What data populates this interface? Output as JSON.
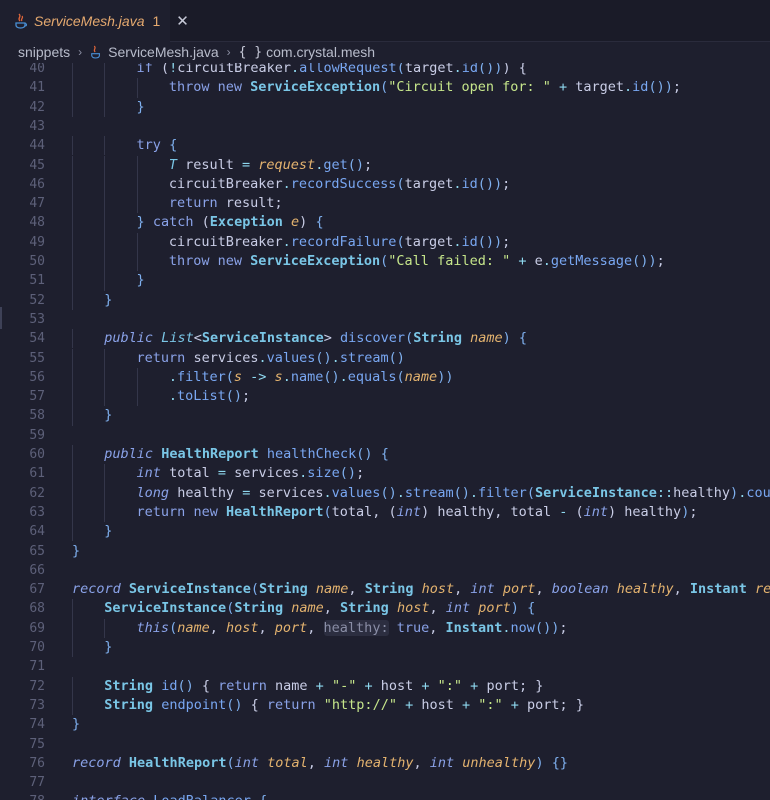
{
  "tab": {
    "title": "ServiceMesh.java",
    "problem_count": "1",
    "close_glyph": "✕",
    "icon": "java-icon"
  },
  "breadcrumb": {
    "items": [
      "snippets",
      "ServiceMesh.java",
      "com.crystal.mesh"
    ],
    "separator": "›",
    "namespace_icon": "{ }"
  },
  "colors": {
    "background": "#1e1f2e",
    "tab_title": "#e5a96f",
    "keyword": "#8aa2e8",
    "type": "#7ac6e6",
    "function": "#79a7f2",
    "parameter": "#e4b36f",
    "string": "#c6e68b",
    "line_number": "#5d6079"
  },
  "lines": [
    {
      "n": "40",
      "indent": 2,
      "t": [
        [
          "kw",
          "if"
        ],
        [
          "pl",
          " ("
        ],
        [
          "op",
          "!"
        ],
        [
          "pl",
          "circuitBreaker"
        ],
        [
          "op",
          "."
        ],
        [
          "fn",
          "allowRequest"
        ],
        [
          "br",
          "("
        ],
        [
          "pl",
          "target"
        ],
        [
          "op",
          "."
        ],
        [
          "fn",
          "id"
        ],
        [
          "br",
          "()"
        ],
        [
          "br",
          ")"
        ],
        [
          "pl",
          ")"
        ],
        [
          "pl",
          " {"
        ]
      ]
    },
    {
      "n": "41",
      "indent": 3,
      "t": [
        [
          "kw",
          "throw new "
        ],
        [
          "ty",
          "ServiceException"
        ],
        [
          "br",
          "("
        ],
        [
          "str",
          "\"Circuit open for: \""
        ],
        [
          "op",
          " + "
        ],
        [
          "pl",
          "target"
        ],
        [
          "op",
          "."
        ],
        [
          "fn",
          "id"
        ],
        [
          "br",
          "()"
        ],
        [
          "br",
          ")"
        ],
        [
          "pl",
          ";"
        ]
      ]
    },
    {
      "n": "42",
      "indent": 2,
      "t": [
        [
          "br",
          "}"
        ]
      ]
    },
    {
      "n": "43",
      "indent": 0,
      "t": []
    },
    {
      "n": "44",
      "indent": 2,
      "t": [
        [
          "kw",
          "try"
        ],
        [
          "pl",
          " "
        ],
        [
          "br",
          "{"
        ]
      ]
    },
    {
      "n": "45",
      "indent": 3,
      "t": [
        [
          "tyi",
          "T"
        ],
        [
          "pl",
          " result "
        ],
        [
          "op",
          "="
        ],
        [
          "pl",
          " "
        ],
        [
          "par",
          "request"
        ],
        [
          "op",
          "."
        ],
        [
          "fn",
          "get"
        ],
        [
          "br",
          "()"
        ],
        [
          "pl",
          ";"
        ]
      ]
    },
    {
      "n": "46",
      "indent": 3,
      "t": [
        [
          "pl",
          "circuitBreaker"
        ],
        [
          "op",
          "."
        ],
        [
          "fn",
          "recordSuccess"
        ],
        [
          "br",
          "("
        ],
        [
          "pl",
          "target"
        ],
        [
          "op",
          "."
        ],
        [
          "fn",
          "id"
        ],
        [
          "br",
          "()"
        ],
        [
          "br",
          ")"
        ],
        [
          "pl",
          ";"
        ]
      ]
    },
    {
      "n": "47",
      "indent": 3,
      "t": [
        [
          "kw",
          "return"
        ],
        [
          "pl",
          " result;"
        ]
      ]
    },
    {
      "n": "48",
      "indent": 2,
      "t": [
        [
          "br",
          "}"
        ],
        [
          "pl",
          " "
        ],
        [
          "kw",
          "catch"
        ],
        [
          "pl",
          " ("
        ],
        [
          "ty",
          "Exception"
        ],
        [
          "pl",
          " "
        ],
        [
          "par",
          "e"
        ],
        [
          "pl",
          ")"
        ],
        [
          "pl",
          " "
        ],
        [
          "br",
          "{"
        ]
      ]
    },
    {
      "n": "49",
      "indent": 3,
      "t": [
        [
          "pl",
          "circuitBreaker"
        ],
        [
          "op",
          "."
        ],
        [
          "fn",
          "recordFailure"
        ],
        [
          "br",
          "("
        ],
        [
          "pl",
          "target"
        ],
        [
          "op",
          "."
        ],
        [
          "fn",
          "id"
        ],
        [
          "br",
          "()"
        ],
        [
          "br",
          ")"
        ],
        [
          "pl",
          ";"
        ]
      ]
    },
    {
      "n": "50",
      "indent": 3,
      "t": [
        [
          "kw",
          "throw new "
        ],
        [
          "ty",
          "ServiceException"
        ],
        [
          "br",
          "("
        ],
        [
          "str",
          "\"Call failed: \""
        ],
        [
          "op",
          " + "
        ],
        [
          "pl",
          "e"
        ],
        [
          "op",
          "."
        ],
        [
          "fn",
          "getMessage"
        ],
        [
          "br",
          "()"
        ],
        [
          "br",
          ")"
        ],
        [
          "pl",
          ";"
        ]
      ]
    },
    {
      "n": "51",
      "indent": 2,
      "t": [
        [
          "br",
          "}"
        ]
      ]
    },
    {
      "n": "52",
      "indent": 1,
      "t": [
        [
          "br",
          "}"
        ]
      ]
    },
    {
      "n": "53",
      "indent": 0,
      "t": []
    },
    {
      "n": "54",
      "indent": 1,
      "t": [
        [
          "kwi",
          "public"
        ],
        [
          "pl",
          " "
        ],
        [
          "tyi",
          "List"
        ],
        [
          "pl",
          "<"
        ],
        [
          "ty",
          "ServiceInstance"
        ],
        [
          "pl",
          "> "
        ],
        [
          "fn",
          "discover"
        ],
        [
          "br",
          "("
        ],
        [
          "ty",
          "String"
        ],
        [
          "pl",
          " "
        ],
        [
          "par",
          "name"
        ],
        [
          "br",
          ")"
        ],
        [
          "pl",
          " "
        ],
        [
          "br",
          "{"
        ]
      ]
    },
    {
      "n": "55",
      "indent": 2,
      "t": [
        [
          "kw",
          "return"
        ],
        [
          "pl",
          " services"
        ],
        [
          "op",
          "."
        ],
        [
          "fn",
          "values"
        ],
        [
          "br",
          "()"
        ],
        [
          "op",
          "."
        ],
        [
          "fn",
          "stream"
        ],
        [
          "br",
          "()"
        ]
      ]
    },
    {
      "n": "56",
      "indent": 3,
      "t": [
        [
          "op",
          "."
        ],
        [
          "fn",
          "filter"
        ],
        [
          "br",
          "("
        ],
        [
          "par",
          "s"
        ],
        [
          "op",
          " -> "
        ],
        [
          "par",
          "s"
        ],
        [
          "op",
          "."
        ],
        [
          "fn",
          "name"
        ],
        [
          "br",
          "()"
        ],
        [
          "op",
          "."
        ],
        [
          "fn",
          "equals"
        ],
        [
          "br",
          "("
        ],
        [
          "par",
          "name"
        ],
        [
          "br",
          "))"
        ]
      ]
    },
    {
      "n": "57",
      "indent": 3,
      "t": [
        [
          "op",
          "."
        ],
        [
          "fn",
          "toList"
        ],
        [
          "br",
          "()"
        ],
        [
          "pl",
          ";"
        ]
      ]
    },
    {
      "n": "58",
      "indent": 1,
      "t": [
        [
          "br",
          "}"
        ]
      ]
    },
    {
      "n": "59",
      "indent": 0,
      "t": []
    },
    {
      "n": "60",
      "indent": 1,
      "t": [
        [
          "kwi",
          "public"
        ],
        [
          "pl",
          " "
        ],
        [
          "ty",
          "HealthReport"
        ],
        [
          "pl",
          " "
        ],
        [
          "fn",
          "healthCheck"
        ],
        [
          "br",
          "()"
        ],
        [
          "pl",
          " "
        ],
        [
          "br",
          "{"
        ]
      ]
    },
    {
      "n": "61",
      "indent": 2,
      "t": [
        [
          "kwi",
          "int"
        ],
        [
          "pl",
          " total "
        ],
        [
          "op",
          "="
        ],
        [
          "pl",
          " services"
        ],
        [
          "op",
          "."
        ],
        [
          "fn",
          "size"
        ],
        [
          "br",
          "()"
        ],
        [
          "pl",
          ";"
        ]
      ]
    },
    {
      "n": "62",
      "indent": 2,
      "t": [
        [
          "kwi",
          "long"
        ],
        [
          "pl",
          " healthy "
        ],
        [
          "op",
          "="
        ],
        [
          "pl",
          " services"
        ],
        [
          "op",
          "."
        ],
        [
          "fn",
          "values"
        ],
        [
          "br",
          "()"
        ],
        [
          "op",
          "."
        ],
        [
          "fn",
          "stream"
        ],
        [
          "br",
          "()"
        ],
        [
          "op",
          "."
        ],
        [
          "fn",
          "filter"
        ],
        [
          "br",
          "("
        ],
        [
          "ty",
          "ServiceInstance"
        ],
        [
          "op",
          "::"
        ],
        [
          "pl",
          "healthy"
        ],
        [
          "br",
          ")"
        ],
        [
          "op",
          "."
        ],
        [
          "fn",
          "count"
        ],
        [
          "br",
          "()"
        ],
        [
          "pl",
          ";"
        ]
      ]
    },
    {
      "n": "63",
      "indent": 2,
      "t": [
        [
          "kw",
          "return new "
        ],
        [
          "ty",
          "HealthReport"
        ],
        [
          "br",
          "("
        ],
        [
          "pl",
          "total, ("
        ],
        [
          "kwi",
          "int"
        ],
        [
          "pl",
          ") healthy, total "
        ],
        [
          "op",
          "-"
        ],
        [
          "pl",
          " ("
        ],
        [
          "kwi",
          "int"
        ],
        [
          "pl",
          ") healthy"
        ],
        [
          "br",
          ")"
        ],
        [
          "pl",
          ";"
        ]
      ]
    },
    {
      "n": "64",
      "indent": 1,
      "t": [
        [
          "br",
          "}"
        ]
      ]
    },
    {
      "n": "65",
      "indent": 0,
      "t": [
        [
          "br",
          "}"
        ]
      ]
    },
    {
      "n": "66",
      "indent": 0,
      "t": []
    },
    {
      "n": "67",
      "indent": 0,
      "t": [
        [
          "kwi",
          "record"
        ],
        [
          "pl",
          " "
        ],
        [
          "ty",
          "ServiceInstance"
        ],
        [
          "br",
          "("
        ],
        [
          "ty",
          "String"
        ],
        [
          "pl",
          " "
        ],
        [
          "par",
          "name"
        ],
        [
          "pl",
          ", "
        ],
        [
          "ty",
          "String"
        ],
        [
          "pl",
          " "
        ],
        [
          "par",
          "host"
        ],
        [
          "pl",
          ", "
        ],
        [
          "kwi",
          "int"
        ],
        [
          "pl",
          " "
        ],
        [
          "par",
          "port"
        ],
        [
          "pl",
          ", "
        ],
        [
          "kwi",
          "boolean"
        ],
        [
          "pl",
          " "
        ],
        [
          "par",
          "healthy"
        ],
        [
          "pl",
          ", "
        ],
        [
          "ty",
          "Instant"
        ],
        [
          "pl",
          " "
        ],
        [
          "par",
          "registeredAt"
        ],
        [
          "br",
          ")"
        ],
        [
          "pl",
          " {"
        ]
      ]
    },
    {
      "n": "68",
      "indent": 1,
      "t": [
        [
          "ty",
          "ServiceInstance"
        ],
        [
          "br",
          "("
        ],
        [
          "ty",
          "String"
        ],
        [
          "pl",
          " "
        ],
        [
          "par",
          "name"
        ],
        [
          "pl",
          ", "
        ],
        [
          "ty",
          "String"
        ],
        [
          "pl",
          " "
        ],
        [
          "par",
          "host"
        ],
        [
          "pl",
          ", "
        ],
        [
          "kwi",
          "int"
        ],
        [
          "pl",
          " "
        ],
        [
          "par",
          "port"
        ],
        [
          "br",
          ")"
        ],
        [
          "pl",
          " "
        ],
        [
          "br",
          "{"
        ]
      ]
    },
    {
      "n": "69",
      "indent": 2,
      "t": [
        [
          "kwi",
          "this"
        ],
        [
          "br",
          "("
        ],
        [
          "par",
          "name"
        ],
        [
          "pl",
          ", "
        ],
        [
          "par",
          "host"
        ],
        [
          "pl",
          ", "
        ],
        [
          "par",
          "port"
        ],
        [
          "pl",
          ", "
        ],
        [
          "hint",
          "healthy:"
        ],
        [
          "pl",
          " "
        ],
        [
          "kw",
          "true"
        ],
        [
          "pl",
          ", "
        ],
        [
          "ty",
          "Instant"
        ],
        [
          "op",
          "."
        ],
        [
          "fn",
          "now"
        ],
        [
          "br",
          "()"
        ],
        [
          "br",
          ")"
        ],
        [
          "pl",
          ";"
        ]
      ]
    },
    {
      "n": "70",
      "indent": 1,
      "t": [
        [
          "br",
          "}"
        ]
      ]
    },
    {
      "n": "71",
      "indent": 0,
      "t": []
    },
    {
      "n": "72",
      "indent": 1,
      "t": [
        [
          "ty",
          "String"
        ],
        [
          "pl",
          " "
        ],
        [
          "fn",
          "id"
        ],
        [
          "br",
          "()"
        ],
        [
          "pl",
          " { "
        ],
        [
          "kw",
          "return"
        ],
        [
          "pl",
          " name "
        ],
        [
          "op",
          "+"
        ],
        [
          "pl",
          " "
        ],
        [
          "str",
          "\"-\""
        ],
        [
          "op",
          " + "
        ],
        [
          "pl",
          "host "
        ],
        [
          "op",
          "+"
        ],
        [
          "pl",
          " "
        ],
        [
          "str",
          "\":\""
        ],
        [
          "op",
          " + "
        ],
        [
          "pl",
          "port; }"
        ]
      ]
    },
    {
      "n": "73",
      "indent": 1,
      "t": [
        [
          "ty",
          "String"
        ],
        [
          "pl",
          " "
        ],
        [
          "fn",
          "endpoint"
        ],
        [
          "br",
          "()"
        ],
        [
          "pl",
          " { "
        ],
        [
          "kw",
          "return"
        ],
        [
          "pl",
          " "
        ],
        [
          "str",
          "\"http://\""
        ],
        [
          "op",
          " + "
        ],
        [
          "pl",
          "host "
        ],
        [
          "op",
          "+"
        ],
        [
          "pl",
          " "
        ],
        [
          "str",
          "\":\""
        ],
        [
          "op",
          " + "
        ],
        [
          "pl",
          "port; }"
        ]
      ]
    },
    {
      "n": "74",
      "indent": 0,
      "t": [
        [
          "br",
          "}"
        ]
      ]
    },
    {
      "n": "75",
      "indent": 0,
      "t": []
    },
    {
      "n": "76",
      "indent": 0,
      "t": [
        [
          "kwi",
          "record"
        ],
        [
          "pl",
          " "
        ],
        [
          "ty",
          "HealthReport"
        ],
        [
          "br",
          "("
        ],
        [
          "kwi",
          "int"
        ],
        [
          "pl",
          " "
        ],
        [
          "par",
          "total"
        ],
        [
          "pl",
          ", "
        ],
        [
          "kwi",
          "int"
        ],
        [
          "pl",
          " "
        ],
        [
          "par",
          "healthy"
        ],
        [
          "pl",
          ", "
        ],
        [
          "kwi",
          "int"
        ],
        [
          "pl",
          " "
        ],
        [
          "par",
          "unhealthy"
        ],
        [
          "br",
          ")"
        ],
        [
          "pl",
          " "
        ],
        [
          "br",
          "{}"
        ]
      ]
    },
    {
      "n": "77",
      "indent": 0,
      "t": []
    },
    {
      "n": "78",
      "indent": 0,
      "t": [
        [
          "kwi",
          "interface"
        ],
        [
          "pl",
          " "
        ],
        [
          "fn",
          "LoadBalancer"
        ],
        [
          "pl",
          " "
        ],
        [
          "br",
          "{"
        ]
      ]
    }
  ]
}
